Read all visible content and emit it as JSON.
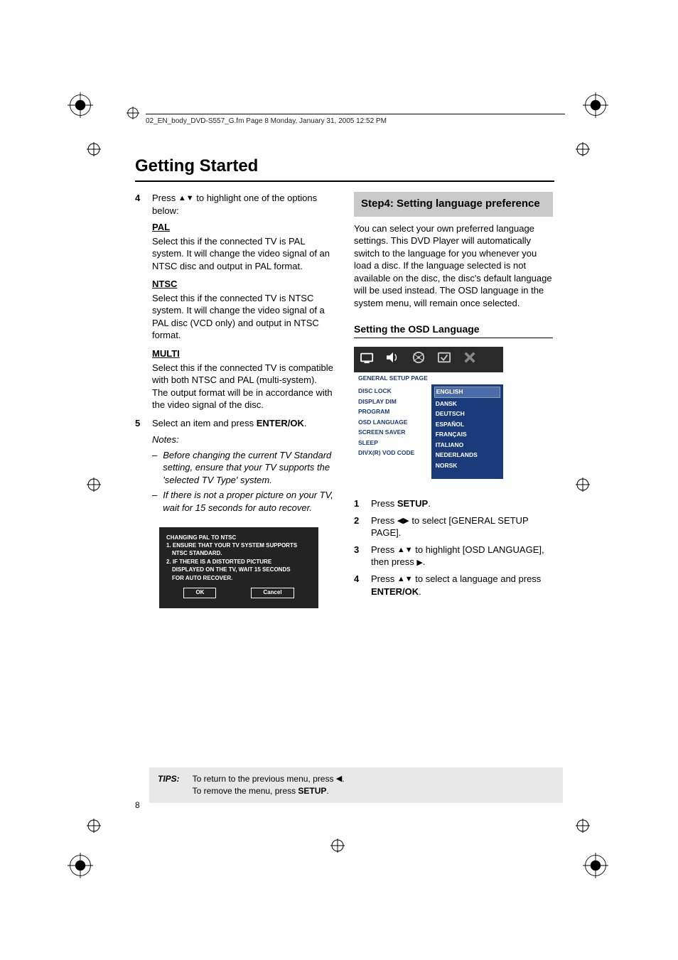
{
  "header": {
    "runner": "02_EN_body_DVD-S557_G.fm  Page 8  Monday, January 31, 2005  12:52 PM"
  },
  "title": "Getting Started",
  "left_column": {
    "step4": {
      "num": "4",
      "text_before": "Press ",
      "text_after": " to highlight one of the options below:"
    },
    "pal": {
      "heading": "PAL",
      "body": "Select this if the connected TV is PAL system. It will change the video signal of an NTSC disc and output in PAL format."
    },
    "ntsc": {
      "heading": "NTSC",
      "body": "Select this if the connected TV is NTSC system. It will change the video signal of a PAL disc (VCD only) and output in NTSC format."
    },
    "multi": {
      "heading": "MULTI",
      "body": "Select this if the connected TV is compatible with both NTSC and PAL (multi-system). The output format will be in accordance with the video signal of the disc."
    },
    "step5": {
      "num": "5",
      "text_before": "Select an item and press ",
      "bold": "ENTER/OK",
      "after": "."
    },
    "notes_label": "Notes:",
    "note1": "Before changing the current TV Standard setting, ensure that your TV supports the 'selected TV Type' system.",
    "note2": "If there is not a proper picture on your TV, wait for 15 seconds for auto recover.",
    "dialog": {
      "title": "CHANGING PAL TO NTSC",
      "l1a": "1. ENSURE THAT YOUR TV SYSTEM SUPPORTS",
      "l1b": "NTSC STANDARD.",
      "l2a": "2. IF THERE IS A DISTORTED PICTURE",
      "l2b": "DISPLAYED ON THE TV, WAIT 15 SECONDS",
      "l2c": "FOR AUTO RECOVER.",
      "ok": "OK",
      "cancel": "Cancel"
    }
  },
  "right_column": {
    "step_title": "Step4: Setting language preference",
    "intro": "You can select your own preferred language settings. This DVD Player will automatically switch to the language for you whenever you load a disc. If the language selected is not available on the disc, the disc's default language will be used instead. The OSD language in the system menu, will remain once selected.",
    "sub_heading": "Setting the OSD Language",
    "osd": {
      "header": "GENERAL SETUP PAGE",
      "left_items": [
        "DISC LOCK",
        "DISPLAY DIM",
        "PROGRAM",
        "OSD LANGUAGE",
        "SCREEN SAVER",
        "SLEEP",
        "DIVX(R) VOD CODE"
      ],
      "right_items": [
        "ENGLISH",
        "DANSK",
        "DEUTSCH",
        "ESPAÑOL",
        "FRANÇAIS",
        "ITALIANO",
        "NEDERLANDS",
        "NORSK"
      ]
    },
    "s1": {
      "num": "1",
      "pre": "Press ",
      "bold": "SETUP",
      "post": "."
    },
    "s2": {
      "num": "2",
      "pre": "Press ",
      "post": " to select [GENERAL SETUP PAGE]."
    },
    "s3": {
      "num": "3",
      "pre": "Press ",
      "mid": " to highlight [OSD LANGUAGE], then press ",
      "post": "."
    },
    "s4": {
      "num": "4",
      "pre": "Press ",
      "mid": " to select a language and press ",
      "bold": "ENTER/OK",
      "post": "."
    }
  },
  "tips": {
    "label": "TIPS:",
    "line1_pre": "To return to the previous menu, press ",
    "line1_post": ".",
    "line2_pre": "To remove the menu, press ",
    "line2_bold": "SETUP",
    "line2_post": "."
  },
  "page_number": "8"
}
